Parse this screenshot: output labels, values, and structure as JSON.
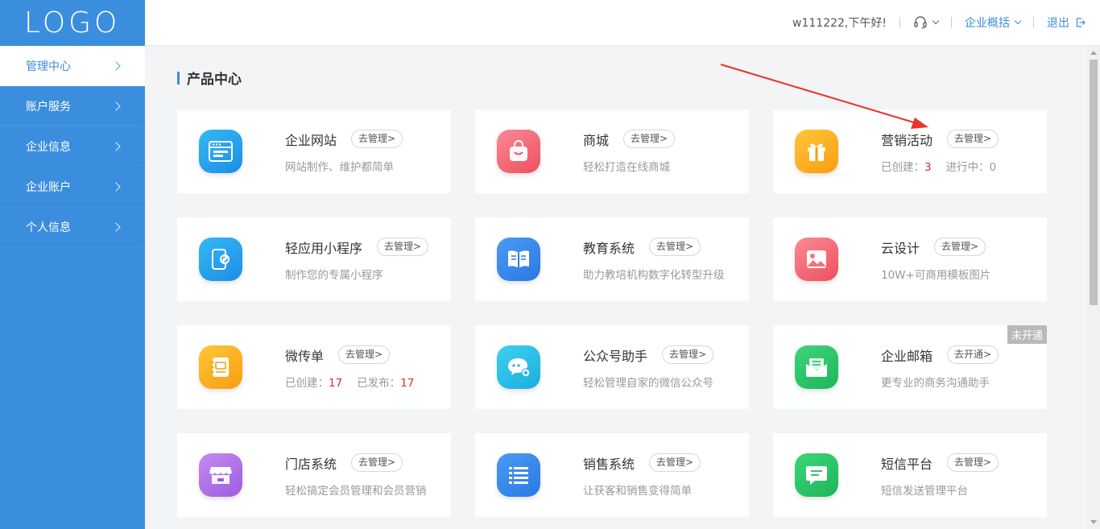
{
  "logo": "LOGO",
  "sidebar": {
    "items": [
      {
        "label": "管理中心"
      },
      {
        "label": "账户服务"
      },
      {
        "label": "企业信息"
      },
      {
        "label": "企业账户"
      },
      {
        "label": "个人信息"
      }
    ]
  },
  "header": {
    "greeting": "w111222,下午好!",
    "overview": "企业概括",
    "logout": "退出"
  },
  "main": {
    "section_title": "产品中心",
    "cards": [
      {
        "title": "企业网站",
        "button": "去管理>",
        "desc": "网站制作、维护都简单",
        "icon": "website-icon"
      },
      {
        "title": "商城",
        "button": "去管理>",
        "desc": "轻松打造在线商城",
        "icon": "shopping-bag-icon"
      },
      {
        "title": "营销活动",
        "button": "去管理>",
        "created_label": "已创建：",
        "created_value": "3",
        "second_label": "进行中：",
        "second_value": "0",
        "icon": "gift-icon"
      },
      {
        "title": "轻应用小程序",
        "button": "去管理>",
        "desc": "制作您的专属小程序",
        "icon": "mini-program-icon"
      },
      {
        "title": "教育系统",
        "button": "去管理>",
        "desc": "助力教培机构数字化转型升级",
        "icon": "book-icon"
      },
      {
        "title": "云设计",
        "button": "去管理>",
        "desc": "10W+可商用模板图片",
        "icon": "image-icon"
      },
      {
        "title": "微传单",
        "button": "去管理>",
        "created_label": "已创建：",
        "created_value": "17",
        "second_label": "已发布：",
        "second_value": "17",
        "icon": "flyer-icon"
      },
      {
        "title": "公众号助手",
        "button": "去管理>",
        "desc": "轻松管理自家的微信公众号",
        "icon": "wechat-icon"
      },
      {
        "title": "企业邮箱",
        "button": "去开通>",
        "desc": "更专业的商务沟通助手",
        "badge": "未开通",
        "icon": "mail-icon"
      },
      {
        "title": "门店系统",
        "button": "去管理>",
        "desc": "轻松搞定会员管理和会员营销",
        "icon": "store-icon"
      },
      {
        "title": "销售系统",
        "button": "去管理>",
        "desc": "让获客和销售变得简单",
        "icon": "list-icon"
      },
      {
        "title": "短信平台",
        "button": "去管理>",
        "desc": "短信发送管理平台",
        "icon": "sms-icon"
      }
    ]
  },
  "colors": {
    "primary": "#3b8ede",
    "accent_number": "#d9302c",
    "annotation_arrow": "#e8342a"
  }
}
